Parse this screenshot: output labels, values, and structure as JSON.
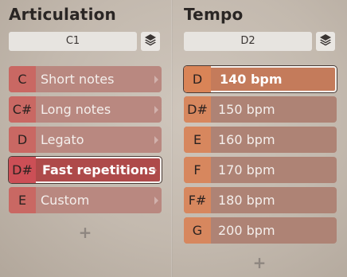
{
  "articulation": {
    "title": "Articulation",
    "key": "C1",
    "items": [
      {
        "note": "C",
        "label": "Short notes",
        "selected": false
      },
      {
        "note": "C#",
        "label": "Long notes",
        "selected": false
      },
      {
        "note": "D",
        "label": "Legato",
        "selected": false
      },
      {
        "note": "D#",
        "label": "Fast repetitions",
        "selected": true
      },
      {
        "note": "E",
        "label": "Custom",
        "selected": false
      }
    ],
    "add_label": "+"
  },
  "tempo": {
    "title": "Tempo",
    "key": "D2",
    "items": [
      {
        "note": "D",
        "label": "140 bpm",
        "selected": true
      },
      {
        "note": "D#",
        "label": "150 bpm",
        "selected": false
      },
      {
        "note": "E",
        "label": "160 bpm",
        "selected": false
      },
      {
        "note": "F",
        "label": "170 bpm",
        "selected": false
      },
      {
        "note": "F#",
        "label": "180 bpm",
        "selected": false
      },
      {
        "note": "G",
        "label": "200 bpm",
        "selected": false
      }
    ],
    "add_label": "+"
  },
  "icons": {
    "layers": "layers-icon",
    "chevron": "chevron-right-icon",
    "add": "plus-icon"
  }
}
